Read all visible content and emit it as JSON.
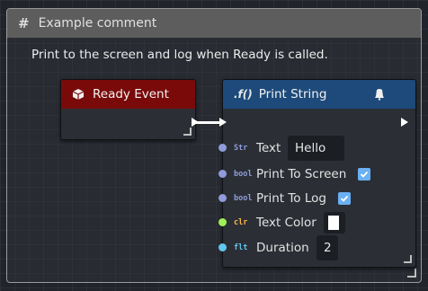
{
  "comment": {
    "title": "Example comment",
    "description": "Print to the screen and log when Ready is called."
  },
  "ready_node": {
    "title": "Ready Event",
    "header_color": "#7a0a0a",
    "icon": "cube-icon"
  },
  "print_node": {
    "title": "Print String",
    "fn_symbol": ".f()",
    "header_color": "#1d4a7a",
    "icon": "bell-icon",
    "inputs": [
      {
        "type_tag": "Str",
        "type_color": "#8f9bdb",
        "pin_color": "#8f9bdb",
        "label": "Text",
        "value": "Hello"
      },
      {
        "type_tag": "bool",
        "type_color": "#8f9bdb",
        "pin_color": "#8f9bdb",
        "label": "Print To Screen",
        "checked": true
      },
      {
        "type_tag": "bool",
        "type_color": "#8f9bdb",
        "pin_color": "#8f9bdb",
        "label": "Print To Log",
        "checked": true
      },
      {
        "type_tag": "clr",
        "type_color": "#ffb84d",
        "pin_color": "#9ef058",
        "label": "Text Color",
        "value_color": "#ffffff"
      },
      {
        "type_tag": "flt",
        "type_color": "#63c6f0",
        "pin_color": "#63c6f0",
        "label": "Duration",
        "value": "2"
      }
    ]
  }
}
